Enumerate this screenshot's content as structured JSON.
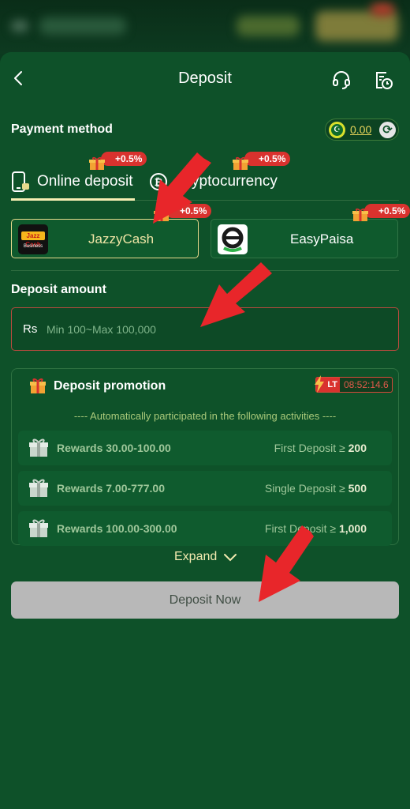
{
  "header": {
    "title": "Deposit"
  },
  "payment_method": {
    "label": "Payment method",
    "balance": "0.00"
  },
  "tabs": [
    {
      "label": "Online deposit",
      "badge": "+0.5%",
      "active": true
    },
    {
      "label": "Cryptocurrency",
      "badge": "+0.5%",
      "active": false
    }
  ],
  "channels": [
    {
      "name": "JazzyCash",
      "badge": "+0.5%",
      "selected": true,
      "logo_text": "Jazz Cash",
      "logo_sub": "Business"
    },
    {
      "name": "EasyPaisa",
      "badge": "+0.5%",
      "selected": false
    }
  ],
  "amount": {
    "label": "Deposit amount",
    "currency": "Rs",
    "placeholder": "Min 100~Max 100,000"
  },
  "promotion": {
    "title": "Deposit promotion",
    "tag": "LT",
    "timer": "08:52:14.6",
    "subtitle": "---- Automatically participated in the following activities ----",
    "rewards": [
      {
        "label": "Rewards 30.00-100.00",
        "cond_prefix": "First Deposit ≥ ",
        "cond_value": "200"
      },
      {
        "label": "Rewards 7.00-777.00",
        "cond_prefix": "Single Deposit ≥ ",
        "cond_value": "500"
      },
      {
        "label": "Rewards 100.00-300.00",
        "cond_prefix": "First Deposit ≥ ",
        "cond_value": "1,000"
      }
    ],
    "expand_label": "Expand"
  },
  "deposit_button": "Deposit Now",
  "colors": {
    "background": "#0e5129",
    "accent_gold": "#e6d98c",
    "badge_red": "#d9322e",
    "annotation_arrow": "#e8262a"
  },
  "icons": [
    "back-arrow-icon",
    "headset-icon",
    "history-icon",
    "pakistan-flag-icon",
    "refresh-icon",
    "phone-icon",
    "crypto-coin-icon",
    "gift-icon",
    "lightning-icon",
    "chevron-down-icon"
  ]
}
